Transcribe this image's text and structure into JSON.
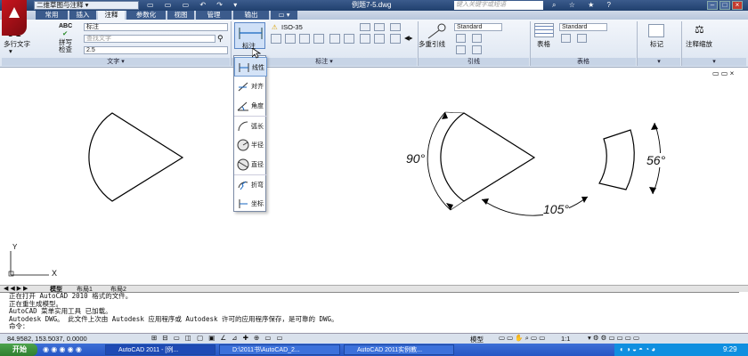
{
  "title_bar": {
    "workspace": "二维草图与注释",
    "document_title": "例题7-5.dwg",
    "help_search_placeholder": "键入关键字或短语"
  },
  "ribbon_tabs": [
    "常用",
    "插入",
    "注释",
    "参数化",
    "视图",
    "管理",
    "输出"
  ],
  "active_tab": "注释",
  "text_panel": {
    "mtext_label": "多行文字",
    "abc_label": "ABC",
    "spell_label": "拼写检查",
    "style_value": "标注",
    "find_placeholder": "查找文字",
    "height_value": "2.5",
    "panel_title": "文字"
  },
  "dim_panel": {
    "dim_button_label": "标注",
    "style_value": "ISO-35",
    "panel_title": "标注"
  },
  "leader_panel": {
    "label": "多重引线",
    "style_value": "Standard",
    "panel_title": "引线"
  },
  "table_panel": {
    "label": "表格",
    "style_value": "Standard",
    "panel_title": "表格"
  },
  "markup_panel": {
    "label": "标记"
  },
  "scale_panel": {
    "label": "注释缩放"
  },
  "dim_dropdown": {
    "items": [
      {
        "label": "线性",
        "icon": "linear-dim-icon"
      },
      {
        "label": "对齐",
        "icon": "aligned-dim-icon"
      },
      {
        "label": "角度",
        "icon": "angular-dim-icon"
      },
      {
        "label": "弧长",
        "icon": "arc-length-icon"
      },
      {
        "label": "半径",
        "icon": "radius-icon"
      },
      {
        "label": "直径",
        "icon": "diameter-icon"
      },
      {
        "label": "折弯",
        "icon": "jogged-icon"
      },
      {
        "label": "坐标",
        "icon": "ordinate-icon"
      }
    ]
  },
  "drawing": {
    "dim_90": "90°",
    "dim_105": "105°",
    "dim_56": "56°"
  },
  "ucs": {
    "x": "X",
    "y": "Y"
  },
  "layout_tabs": [
    "模型",
    "布局1",
    "布局2"
  ],
  "command_history": [
    "正在打开 AutoCAD 2010 格式的文件。",
    "正在重生成模型。",
    "AutoCAD 菜单实用工具 已加载。",
    "Autodesk DWG。  此文件上次由 Autodesk 应用程序或 Autodesk 许可的应用程序保存，是可靠的 DWG。",
    "命令："
  ],
  "status": {
    "coords": "84.9582, 153.5037, 0.0000",
    "model_label": "模型",
    "scale": "1:1"
  },
  "taskbar": {
    "start_label": "开始",
    "tasks": [
      "AutoCAD 2011 - [例...",
      "D:\\2011书\\AutoCAD_2...",
      "AutoCAD 2011实例教..."
    ],
    "time": "9:29"
  }
}
